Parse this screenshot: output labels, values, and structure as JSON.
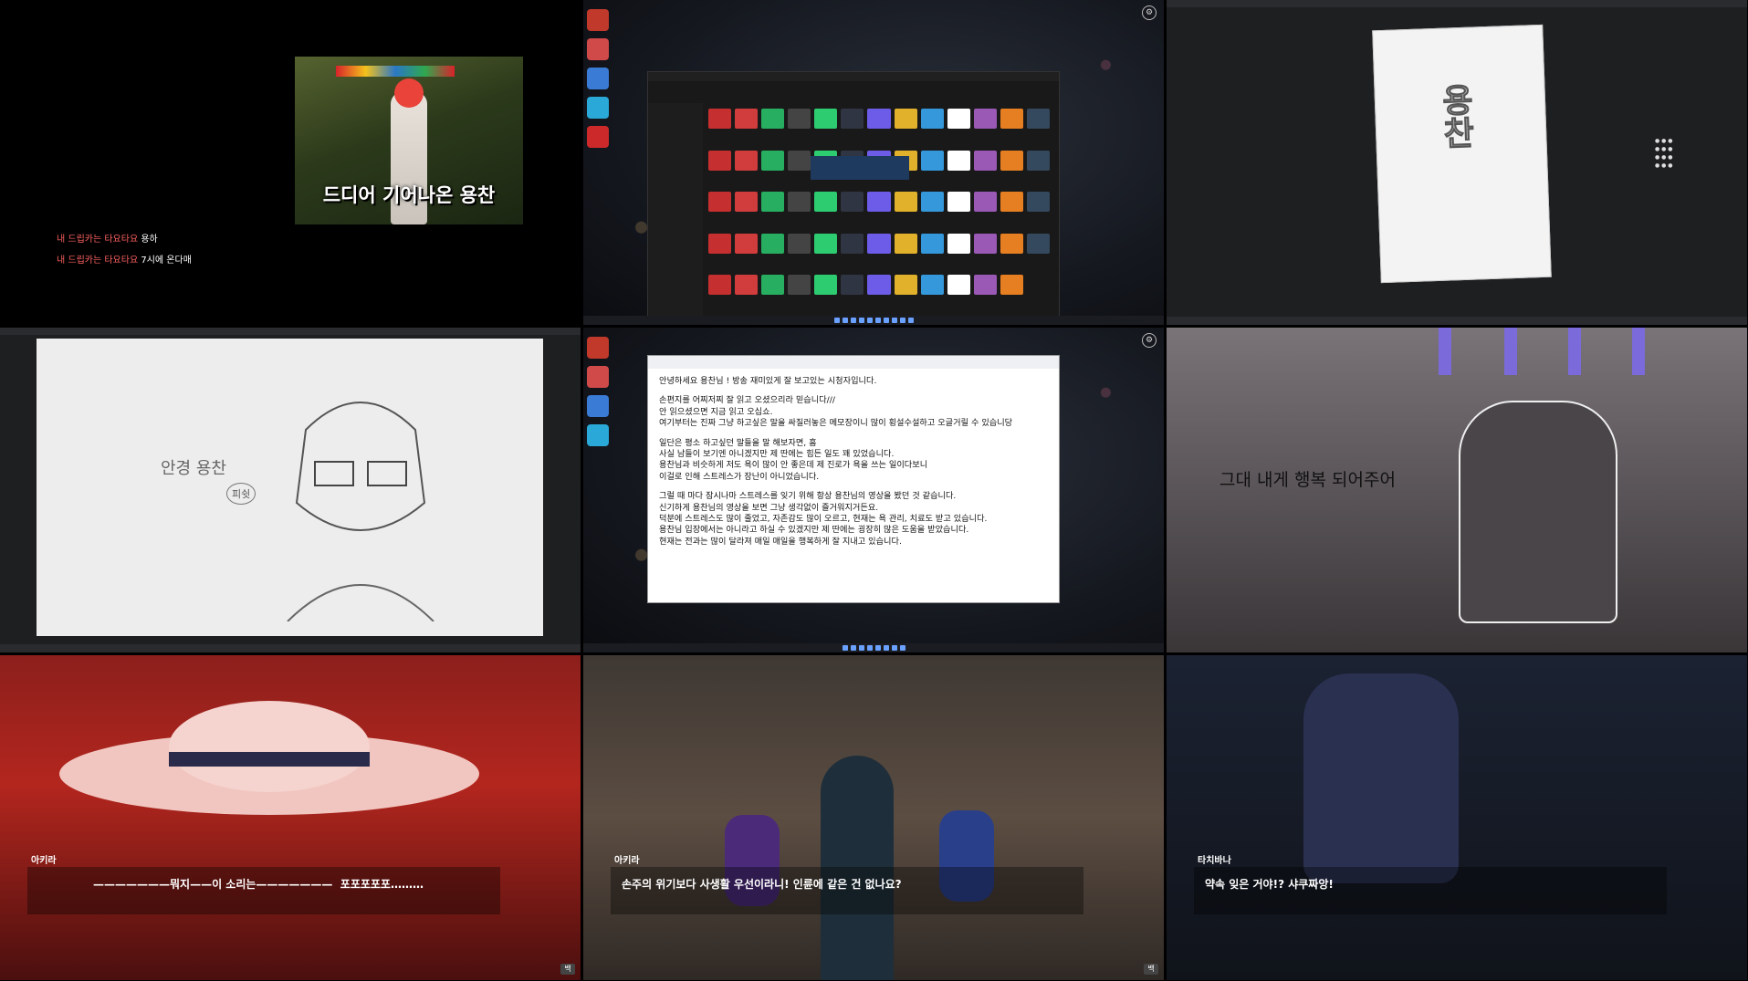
{
  "tile1": {
    "caption": "드디어 기어나온 용찬",
    "chat": [
      {
        "name": "내 드립카는 타요타요",
        "msg": "용하"
      },
      {
        "name": "내 드립카는 타요타요",
        "msg": "7시에 온다매"
      }
    ]
  },
  "tile2": {
    "files_count": 64
  },
  "tile5": {
    "lines": [
      "안녕하세요 용찬님 ! 방송 재미있게 잘 보고있는 시청자입니다.",
      "",
      "손편지를 어찌저찌 잘 읽고 오셨으리라 믿습니다///",
      "안 읽으셨으면 지금 읽고 오십쇼.",
      "여기부터는 진짜 그냥 하고싶은 말을 싸질러놓은 메모장이니 많이 횡설수설하고 오글거릴 수 있습니당",
      "",
      "일단은 평소 하고싶던 말들을 말 해보자면, 흠",
      "사실 남들이 보기엔 아니겠지만 제 딴에는 힘든 일도 꽤 있었습니다.",
      "용찬님과 비슷하게 저도 욕이 많이 안 좋은데 제 진로가 욕을 쓰는 일이다보니",
      "이걸로 인해 스트레스가 장난이 아니었습니다.",
      "",
      "그럴 때 마다 잠시나마 스트레스를 잊기 위해 항상 용찬님의 영상을 봤던 것 같습니다.",
      "신기하게 용찬님의 영상을 보면 그냥 생각없이 즐거워지거든요.",
      "덕분에 스트레스도 많이 줄었고, 자존감도 많이 오르고, 현재는 욕 관리, 치료도 받고 있습니다.",
      "용찬님 입장에서는 아니라고 하실 수 있겠지만 제 딴에는 굉장히 많은 도움을 받았습니다.",
      "현재는 전과는 많이 달라져 매일 매일을 행복하게 잘 지내고 있습니다."
    ]
  },
  "tile4": {
    "label": "안경 용찬",
    "bubble": "피쉿"
  },
  "tile6": {
    "line": "그대 내게 행복 되어주어"
  },
  "tile7": {
    "speaker": "아키라",
    "line": "———————뭐지——이 소리는———————  포포포포포………"
  },
  "tile8": {
    "speaker": "아키라",
    "line": "손주의 위기보다 사생활 우선이라니! 인륜에 같은 건 없나요?"
  },
  "tile9": {
    "speaker": "타치바나",
    "line": "약속 잊은 거야!? 샤쿠짜앙!"
  },
  "corner_icon": "백"
}
